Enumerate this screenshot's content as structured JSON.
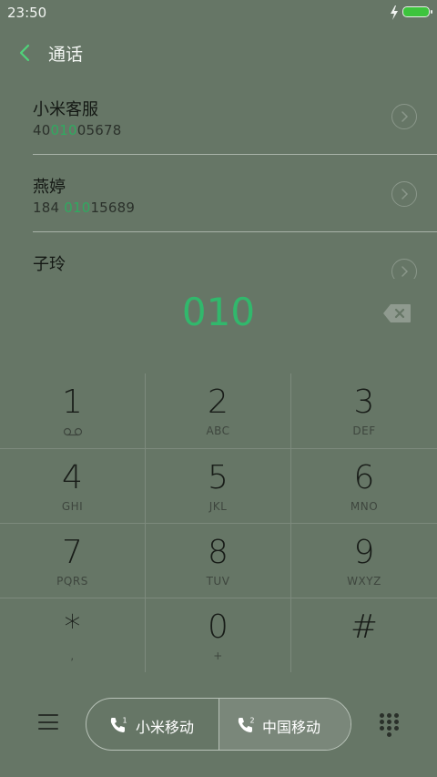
{
  "status": {
    "time": "23:50"
  },
  "header": {
    "title": "通话"
  },
  "contacts": [
    {
      "name": "小米客服",
      "num_pre": "40",
      "num_match": "010",
      "num_post": "05678"
    },
    {
      "name": "燕婷",
      "num_pre": "184 ",
      "num_match": "010",
      "num_post": "15689"
    },
    {
      "name": "子玲"
    }
  ],
  "dialer": {
    "digits": "010"
  },
  "keys": [
    {
      "digit": "1",
      "letters": ""
    },
    {
      "digit": "2",
      "letters": "ABC"
    },
    {
      "digit": "3",
      "letters": "DEF"
    },
    {
      "digit": "4",
      "letters": "GHI"
    },
    {
      "digit": "5",
      "letters": "JKL"
    },
    {
      "digit": "6",
      "letters": "MNO"
    },
    {
      "digit": "7",
      "letters": "PQRS"
    },
    {
      "digit": "8",
      "letters": "TUV"
    },
    {
      "digit": "9",
      "letters": "WXYZ"
    },
    {
      "digit": "*",
      "letters": ","
    },
    {
      "digit": "0",
      "letters": "+"
    },
    {
      "digit": "#",
      "letters": ""
    }
  ],
  "sim": [
    {
      "index": "1",
      "label": "小米移动"
    },
    {
      "index": "2",
      "label": "中国移动"
    }
  ],
  "colors": {
    "background": "#667666",
    "accent": "#31b86c",
    "battery": "#3dc43d"
  },
  "icons": [
    "bolt-icon",
    "battery-icon",
    "back-arrow-icon",
    "chevron-right-icon",
    "backspace-icon",
    "voicemail-icon",
    "menu-icon",
    "phone-icon",
    "dialpad-icon"
  ]
}
